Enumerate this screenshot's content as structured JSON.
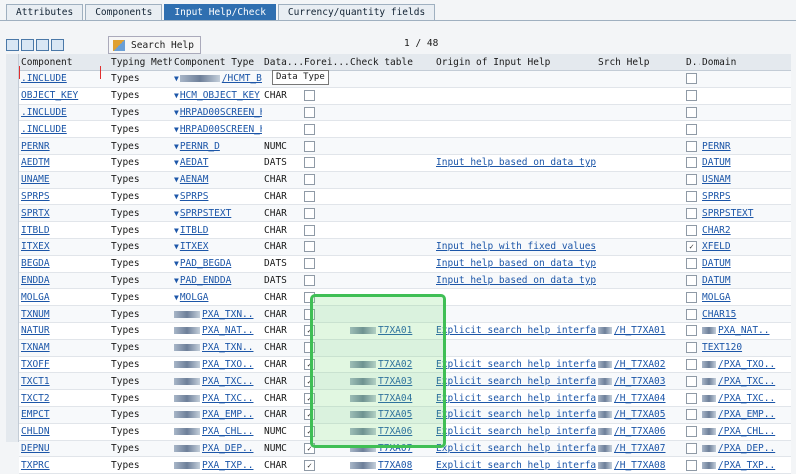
{
  "tabs": [
    "Attributes",
    "Components",
    "Input Help/Check",
    "Currency/quantity fields"
  ],
  "toolbar": {
    "search_help_label": "Search Help",
    "pager": "1 / 48"
  },
  "columns": [
    "Component",
    "Typing Method",
    "Component Type",
    "Data...",
    "Forei...",
    "Check table",
    "Origin of Input Help",
    "Srch Help",
    "D..",
    "Domain"
  ],
  "tooltip": "Data Type",
  "rows": [
    {
      "comp": ".INCLUDE",
      "tm": "Types",
      "ct": "/HCMT_BS..",
      "dt": "",
      "fk": "",
      "chk": "",
      "orig": "",
      "sh": "",
      "d": "",
      "dom": ""
    },
    {
      "comp": "OBJECT_KEY",
      "tm": "Types",
      "ct": "HCM_OBJECT_KEY",
      "dt": "CHAR",
      "fk": "",
      "chk": "",
      "orig": "",
      "sh": "",
      "d": "",
      "dom": ""
    },
    {
      "comp": ".INCLUDE",
      "tm": "Types",
      "ct": "HRPAD00SCREEN_H..",
      "dt": "",
      "fk": "",
      "chk": "",
      "orig": "",
      "sh": "",
      "d": "",
      "dom": ""
    },
    {
      "comp": ".INCLUDE",
      "tm": "Types",
      "ct": "HRPAD00SCREEN_H..",
      "dt": "",
      "fk": "",
      "chk": "",
      "orig": "",
      "sh": "",
      "d": "",
      "dom": ""
    },
    {
      "comp": "PERNR",
      "tm": "Types",
      "ct": "PERNR_D",
      "dt": "NUMC",
      "fk": "",
      "chk": "",
      "orig": "",
      "sh": "",
      "d": "",
      "dom": "PERNR"
    },
    {
      "comp": "AEDTM",
      "tm": "Types",
      "ct": "AEDAT",
      "dt": "DATS",
      "fk": "",
      "chk": "",
      "orig": "Input help based on data type",
      "sh": "",
      "d": "",
      "dom": "DATUM"
    },
    {
      "comp": "UNAME",
      "tm": "Types",
      "ct": "AENAM",
      "dt": "CHAR",
      "fk": "",
      "chk": "",
      "orig": "",
      "sh": "",
      "d": "",
      "dom": "USNAM"
    },
    {
      "comp": "SPRPS",
      "tm": "Types",
      "ct": "SPRPS",
      "dt": "CHAR",
      "fk": "",
      "chk": "",
      "orig": "",
      "sh": "",
      "d": "",
      "dom": "SPRPS"
    },
    {
      "comp": "SPRTX",
      "tm": "Types",
      "ct": "SPRPSTEXT",
      "dt": "CHAR",
      "fk": "",
      "chk": "",
      "orig": "",
      "sh": "",
      "d": "",
      "dom": "SPRPSTEXT"
    },
    {
      "comp": "ITBLD",
      "tm": "Types",
      "ct": "ITBLD",
      "dt": "CHAR",
      "fk": "",
      "chk": "",
      "orig": "",
      "sh": "",
      "d": "",
      "dom": "CHAR2"
    },
    {
      "comp": "ITXEX",
      "tm": "Types",
      "ct": "ITXEX",
      "dt": "CHAR",
      "fk": "",
      "chk": "",
      "orig": "Input help with fixed values",
      "sh": "",
      "d": "✓",
      "dom": "XFELD"
    },
    {
      "comp": "BEGDA",
      "tm": "Types",
      "ct": "PAD_BEGDA",
      "dt": "DATS",
      "fk": "",
      "chk": "",
      "orig": "Input help based on data type",
      "sh": "",
      "d": "",
      "dom": "DATUM"
    },
    {
      "comp": "ENDDA",
      "tm": "Types",
      "ct": "PAD_ENDDA",
      "dt": "DATS",
      "fk": "",
      "chk": "",
      "orig": "Input help based on data type",
      "sh": "",
      "d": "",
      "dom": "DATUM"
    },
    {
      "comp": "MOLGA",
      "tm": "Types",
      "ct": "MOLGA",
      "dt": "CHAR",
      "fk": "",
      "chk": "",
      "orig": "",
      "sh": "",
      "d": "",
      "dom": "MOLGA"
    },
    {
      "comp": "TXNUM",
      "tm": "Types",
      "ct": "PXA_TXN..",
      "dt": "CHAR",
      "fk": "",
      "chk": "",
      "orig": "",
      "sh": "",
      "d": "",
      "dom": "CHAR15"
    },
    {
      "comp": "NATUR",
      "tm": "Types",
      "ct": "PXA_NAT..",
      "dt": "CHAR",
      "fk": "✓",
      "chk": "T7XA01",
      "orig": "Explicit search help interfac..",
      "sh": "/H_T7XA01",
      "d": "",
      "dom": "PXA_NAT.."
    },
    {
      "comp": "TXNAM",
      "tm": "Types",
      "ct": "PXA_TXN..",
      "dt": "CHAR",
      "fk": "",
      "chk": "",
      "orig": "",
      "sh": "",
      "d": "",
      "dom": "TEXT120"
    },
    {
      "comp": "TXOFF",
      "tm": "Types",
      "ct": "PXA_TXO..",
      "dt": "CHAR",
      "fk": "✓",
      "chk": "T7XA02",
      "orig": "Explicit search help interfac..",
      "sh": "/H_T7XA02",
      "d": "",
      "dom": "/PXA_TXO.."
    },
    {
      "comp": "TXCT1",
      "tm": "Types",
      "ct": "PXA_TXC..",
      "dt": "CHAR",
      "fk": "✓",
      "chk": "T7XA03",
      "orig": "Explicit search help interfac..",
      "sh": "/H_T7XA03",
      "d": "",
      "dom": "/PXA_TXC.."
    },
    {
      "comp": "TXCT2",
      "tm": "Types",
      "ct": "PXA_TXC..",
      "dt": "CHAR",
      "fk": "✓",
      "chk": "T7XA04",
      "orig": "Explicit search help interfac..",
      "sh": "/H_T7XA04",
      "d": "",
      "dom": "/PXA_TXC.."
    },
    {
      "comp": "EMPCT",
      "tm": "Types",
      "ct": "PXA_EMP..",
      "dt": "CHAR",
      "fk": "✓",
      "chk": "T7XA05",
      "orig": "Explicit search help interfac..",
      "sh": "/H_T7XA05",
      "d": "",
      "dom": "/PXA_EMP.."
    },
    {
      "comp": "CHLDN",
      "tm": "Types",
      "ct": "PXA_CHL..",
      "dt": "NUMC",
      "fk": "✓",
      "chk": "T7XA06",
      "orig": "Explicit search help interfac..",
      "sh": "/H_T7XA06",
      "d": "",
      "dom": "/PXA_CHL.."
    },
    {
      "comp": "DEPNU",
      "tm": "Types",
      "ct": "PXA_DEP..",
      "dt": "NUMC",
      "fk": "✓",
      "chk": "T7XA07",
      "orig": "Explicit search help interfac..",
      "sh": "/H_T7XA07",
      "d": "",
      "dom": "/PXA_DEP.."
    },
    {
      "comp": "TXPRC",
      "tm": "Types",
      "ct": "PXA_TXP..",
      "dt": "CHAR",
      "fk": "✓",
      "chk": "T7XA08",
      "orig": "Explicit search help interfac..",
      "sh": "/H_T7XA08",
      "d": "",
      "dom": "/PXA_TXP.."
    }
  ]
}
